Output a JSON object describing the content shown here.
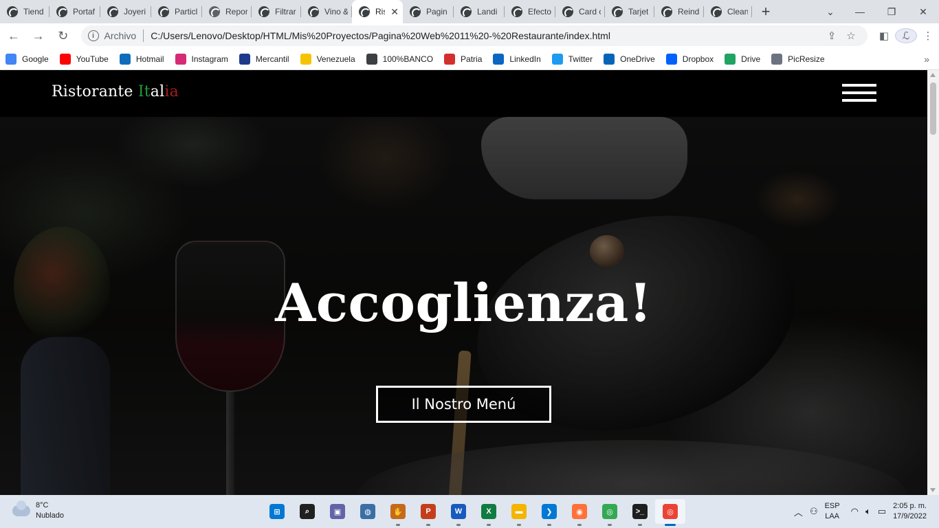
{
  "browser": {
    "tabs": [
      {
        "title": "Tiend",
        "icon": "chrome-globe-icon"
      },
      {
        "title": "Portaf",
        "icon": "chrome-globe-icon"
      },
      {
        "title": "Joyeri",
        "icon": "chrome-globe-icon"
      },
      {
        "title": "Particl",
        "icon": "chrome-globe-icon"
      },
      {
        "title": "Repor",
        "icon": "web-globe-icon"
      },
      {
        "title": "Filtrar",
        "icon": "chrome-globe-icon"
      },
      {
        "title": "Vino &",
        "icon": "chrome-globe-icon"
      },
      {
        "title": "Ris",
        "icon": "chrome-globe-icon",
        "active": true
      },
      {
        "title": "Pagin",
        "icon": "chrome-globe-icon"
      },
      {
        "title": "Landi",
        "icon": "chrome-globe-icon"
      },
      {
        "title": "Efecto",
        "icon": "chrome-globe-icon"
      },
      {
        "title": "Card c",
        "icon": "chrome-globe-icon"
      },
      {
        "title": "Tarjet",
        "icon": "chrome-globe-icon"
      },
      {
        "title": "Reind",
        "icon": "chrome-globe-icon"
      },
      {
        "title": "Clean",
        "icon": "chrome-globe-icon"
      }
    ],
    "new_tab": "+",
    "close_tab": "✕",
    "address": {
      "scheme_label": "Archivo",
      "url": "C:/Users/Lenovo/Desktop/HTML/Mis%20Proyectos/Pagina%20Web%2011%20-%20Restaurante/index.html"
    },
    "bookmarks": [
      {
        "label": "Google",
        "icon": "google-icon",
        "color": "#4285f4"
      },
      {
        "label": "YouTube",
        "icon": "youtube-icon",
        "color": "#ff0000"
      },
      {
        "label": "Hotmail",
        "icon": "outlook-icon",
        "color": "#0f6cbd"
      },
      {
        "label": "Instagram",
        "icon": "instagram-icon",
        "color": "#d62976"
      },
      {
        "label": "Mercantil",
        "icon": "mercantil-icon",
        "color": "#1e3a8a"
      },
      {
        "label": "Venezuela",
        "icon": "venezuela-icon",
        "color": "#f5c400"
      },
      {
        "label": "100%BANCO",
        "icon": "globe-icon",
        "color": "#3c4043"
      },
      {
        "label": "Patria",
        "icon": "patria-icon",
        "color": "#d32f2f"
      },
      {
        "label": "LinkedIn",
        "icon": "linkedin-icon",
        "color": "#0a66c2"
      },
      {
        "label": "Twitter",
        "icon": "twitter-icon",
        "color": "#1d9bf0"
      },
      {
        "label": "OneDrive",
        "icon": "onedrive-icon",
        "color": "#0364b8"
      },
      {
        "label": "Dropbox",
        "icon": "dropbox-icon",
        "color": "#0061ff"
      },
      {
        "label": "Drive",
        "icon": "drive-icon",
        "color": "#1fa463"
      },
      {
        "label": "PicResize",
        "icon": "picresize-icon",
        "color": "#6b7280"
      }
    ]
  },
  "site": {
    "logo_part1": "Ristorante ",
    "logo_it": "It",
    "logo_al": "al",
    "logo_ia": "ia",
    "colors": {
      "green": "#1f9d3a",
      "white": "#ffffff",
      "red": "#a51d1d"
    },
    "hero_title": "Accoglienza!",
    "hero_button": "Il Nostro Menú"
  },
  "taskbar": {
    "weather_temp": "8°C",
    "weather_desc": "Nublado",
    "apps": [
      {
        "name": "windows-start-icon",
        "glyph": "⊞",
        "color": "#0078d4"
      },
      {
        "name": "search-icon",
        "glyph": "⌕",
        "color": "#202020"
      },
      {
        "name": "teams-chat-icon",
        "glyph": "▣",
        "color": "#6264a7"
      },
      {
        "name": "media-app-icon",
        "glyph": "◍",
        "color": "#3b6ea5"
      },
      {
        "name": "game-app-icon",
        "glyph": "✋",
        "color": "#c46a1a"
      },
      {
        "name": "powerpoint-icon",
        "glyph": "P",
        "color": "#c43e1c"
      },
      {
        "name": "word-icon",
        "glyph": "W",
        "color": "#185abd"
      },
      {
        "name": "excel-icon",
        "glyph": "X",
        "color": "#107c41"
      },
      {
        "name": "file-explorer-icon",
        "glyph": "▬",
        "color": "#f4b400"
      },
      {
        "name": "vscode-icon",
        "glyph": "❯",
        "color": "#0078d4"
      },
      {
        "name": "firefox-icon",
        "glyph": "◉",
        "color": "#ff7139"
      },
      {
        "name": "chrome-icon",
        "glyph": "◎",
        "color": "#34a853"
      },
      {
        "name": "terminal-icon",
        "glyph": ">_",
        "color": "#1e1e1e"
      },
      {
        "name": "chrome-profile-icon",
        "glyph": "◎",
        "color": "#ea4335",
        "active": true
      }
    ],
    "lang_1": "ESP",
    "lang_2": "LAA",
    "time": "2:05 p. m.",
    "date": "17/9/2022"
  }
}
